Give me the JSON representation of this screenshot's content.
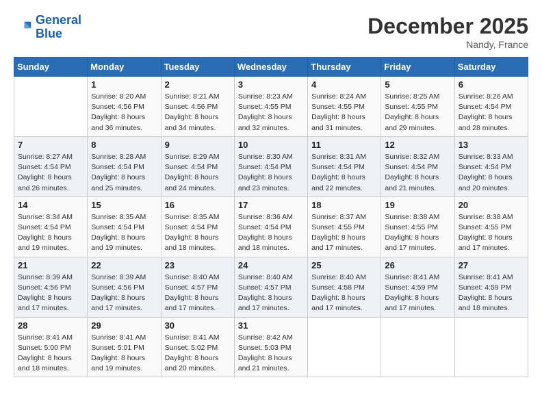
{
  "logo": {
    "line1": "General",
    "line2": "Blue"
  },
  "title": "December 2025",
  "location": "Nandy, France",
  "days_header": [
    "Sunday",
    "Monday",
    "Tuesday",
    "Wednesday",
    "Thursday",
    "Friday",
    "Saturday"
  ],
  "weeks": [
    [
      {
        "day": "",
        "info": ""
      },
      {
        "day": "1",
        "info": "Sunrise: 8:20 AM\nSunset: 4:56 PM\nDaylight: 8 hours\nand 36 minutes."
      },
      {
        "day": "2",
        "info": "Sunrise: 8:21 AM\nSunset: 4:56 PM\nDaylight: 8 hours\nand 34 minutes."
      },
      {
        "day": "3",
        "info": "Sunrise: 8:23 AM\nSunset: 4:55 PM\nDaylight: 8 hours\nand 32 minutes."
      },
      {
        "day": "4",
        "info": "Sunrise: 8:24 AM\nSunset: 4:55 PM\nDaylight: 8 hours\nand 31 minutes."
      },
      {
        "day": "5",
        "info": "Sunrise: 8:25 AM\nSunset: 4:55 PM\nDaylight: 8 hours\nand 29 minutes."
      },
      {
        "day": "6",
        "info": "Sunrise: 8:26 AM\nSunset: 4:54 PM\nDaylight: 8 hours\nand 28 minutes."
      }
    ],
    [
      {
        "day": "7",
        "info": "Sunrise: 8:27 AM\nSunset: 4:54 PM\nDaylight: 8 hours\nand 26 minutes."
      },
      {
        "day": "8",
        "info": "Sunrise: 8:28 AM\nSunset: 4:54 PM\nDaylight: 8 hours\nand 25 minutes."
      },
      {
        "day": "9",
        "info": "Sunrise: 8:29 AM\nSunset: 4:54 PM\nDaylight: 8 hours\nand 24 minutes."
      },
      {
        "day": "10",
        "info": "Sunrise: 8:30 AM\nSunset: 4:54 PM\nDaylight: 8 hours\nand 23 minutes."
      },
      {
        "day": "11",
        "info": "Sunrise: 8:31 AM\nSunset: 4:54 PM\nDaylight: 8 hours\nand 22 minutes."
      },
      {
        "day": "12",
        "info": "Sunrise: 8:32 AM\nSunset: 4:54 PM\nDaylight: 8 hours\nand 21 minutes."
      },
      {
        "day": "13",
        "info": "Sunrise: 8:33 AM\nSunset: 4:54 PM\nDaylight: 8 hours\nand 20 minutes."
      }
    ],
    [
      {
        "day": "14",
        "info": "Sunrise: 8:34 AM\nSunset: 4:54 PM\nDaylight: 8 hours\nand 19 minutes."
      },
      {
        "day": "15",
        "info": "Sunrise: 8:35 AM\nSunset: 4:54 PM\nDaylight: 8 hours\nand 19 minutes."
      },
      {
        "day": "16",
        "info": "Sunrise: 8:35 AM\nSunset: 4:54 PM\nDaylight: 8 hours\nand 18 minutes."
      },
      {
        "day": "17",
        "info": "Sunrise: 8:36 AM\nSunset: 4:54 PM\nDaylight: 8 hours\nand 18 minutes."
      },
      {
        "day": "18",
        "info": "Sunrise: 8:37 AM\nSunset: 4:55 PM\nDaylight: 8 hours\nand 17 minutes."
      },
      {
        "day": "19",
        "info": "Sunrise: 8:38 AM\nSunset: 4:55 PM\nDaylight: 8 hours\nand 17 minutes."
      },
      {
        "day": "20",
        "info": "Sunrise: 8:38 AM\nSunset: 4:55 PM\nDaylight: 8 hours\nand 17 minutes."
      }
    ],
    [
      {
        "day": "21",
        "info": "Sunrise: 8:39 AM\nSunset: 4:56 PM\nDaylight: 8 hours\nand 17 minutes."
      },
      {
        "day": "22",
        "info": "Sunrise: 8:39 AM\nSunset: 4:56 PM\nDaylight: 8 hours\nand 17 minutes."
      },
      {
        "day": "23",
        "info": "Sunrise: 8:40 AM\nSunset: 4:57 PM\nDaylight: 8 hours\nand 17 minutes."
      },
      {
        "day": "24",
        "info": "Sunrise: 8:40 AM\nSunset: 4:57 PM\nDaylight: 8 hours\nand 17 minutes."
      },
      {
        "day": "25",
        "info": "Sunrise: 8:40 AM\nSunset: 4:58 PM\nDaylight: 8 hours\nand 17 minutes."
      },
      {
        "day": "26",
        "info": "Sunrise: 8:41 AM\nSunset: 4:59 PM\nDaylight: 8 hours\nand 17 minutes."
      },
      {
        "day": "27",
        "info": "Sunrise: 8:41 AM\nSunset: 4:59 PM\nDaylight: 8 hours\nand 18 minutes."
      }
    ],
    [
      {
        "day": "28",
        "info": "Sunrise: 8:41 AM\nSunset: 5:00 PM\nDaylight: 8 hours\nand 18 minutes."
      },
      {
        "day": "29",
        "info": "Sunrise: 8:41 AM\nSunset: 5:01 PM\nDaylight: 8 hours\nand 19 minutes."
      },
      {
        "day": "30",
        "info": "Sunrise: 8:41 AM\nSunset: 5:02 PM\nDaylight: 8 hours\nand 20 minutes."
      },
      {
        "day": "31",
        "info": "Sunrise: 8:42 AM\nSunset: 5:03 PM\nDaylight: 8 hours\nand 21 minutes."
      },
      {
        "day": "",
        "info": ""
      },
      {
        "day": "",
        "info": ""
      },
      {
        "day": "",
        "info": ""
      }
    ]
  ]
}
